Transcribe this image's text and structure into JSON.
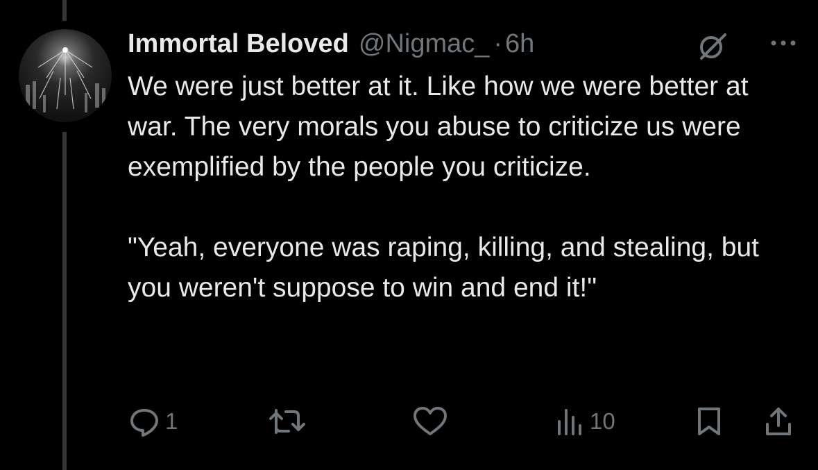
{
  "tweet": {
    "author_name": "Immortal Beloved",
    "handle": "@Nigmac_",
    "separator": "·",
    "time": "6h",
    "text": "We were just better at it. Like how we were better at war. The very morals you abuse to criticize us were exemplified by the people you criticize.\n\n\"Yeah, everyone was raping, killing, and stealing, but you weren't suppose to win and end it!\""
  },
  "actions": {
    "reply_count": "1",
    "retweet_count": "",
    "like_count": "",
    "views_count": "10"
  },
  "icons": [
    "avatar",
    "grok-icon",
    "more-icon",
    "reply-icon",
    "retweet-icon",
    "like-icon",
    "views-icon",
    "bookmark-icon",
    "share-icon"
  ],
  "colors": {
    "background": "#000000",
    "text": "#e7e9ea",
    "secondary": "#71767b",
    "thread_line": "#333639"
  }
}
